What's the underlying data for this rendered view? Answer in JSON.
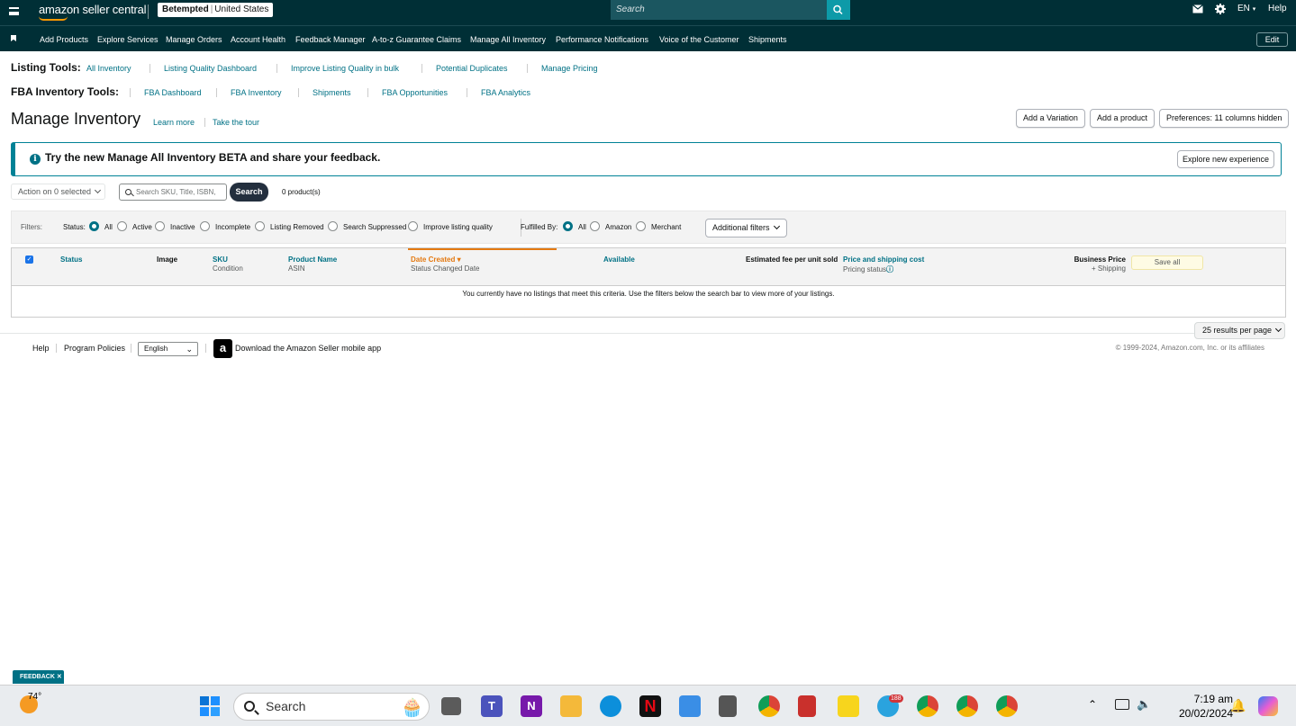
{
  "topbar": {
    "logo": "amazon seller central",
    "store_name": "Betempted",
    "store_region": "United States",
    "search_placeholder": "Search",
    "language": "EN",
    "help": "Help"
  },
  "nav": {
    "items": [
      "Add Products",
      "Explore Services",
      "Manage Orders",
      "Account Health",
      "Feedback Manager",
      "A-to-z Guarantee Claims",
      "Manage All Inventory",
      "Performance Notifications",
      "Voice of the Customer",
      "Shipments"
    ],
    "edit": "Edit"
  },
  "listing_tools": {
    "label": "Listing Tools:",
    "links": [
      "All Inventory",
      "Listing Quality Dashboard",
      "Improve Listing Quality in bulk",
      "Potential Duplicates",
      "Manage Pricing"
    ]
  },
  "fba_tools": {
    "label": "FBA Inventory Tools:",
    "links": [
      "FBA Dashboard",
      "FBA Inventory",
      "Shipments",
      "FBA Opportunities",
      "FBA Analytics"
    ]
  },
  "header": {
    "title": "Manage Inventory",
    "learn_more": "Learn more",
    "take_tour": "Take the tour",
    "add_variation": "Add a Variation",
    "add_product": "Add a product",
    "preferences": "Preferences: 11 columns hidden"
  },
  "banner": {
    "text": "Try the new Manage All Inventory BETA and share your feedback.",
    "button": "Explore new experience"
  },
  "toolbar": {
    "action": "Action on 0 selected",
    "search_placeholder": "Search SKU, Title, ISBN,",
    "search_button": "Search",
    "count": "0 product(s)"
  },
  "filters": {
    "label": "Filters:",
    "status_label": "Status:",
    "status_options": [
      "All",
      "Active",
      "Inactive",
      "Incomplete",
      "Listing Removed",
      "Search Suppressed",
      "Improve listing quality"
    ],
    "status_selected": "All",
    "fulfilled_label": "Fulfilled By:",
    "fulfilled_options": [
      "All",
      "Amazon",
      "Merchant"
    ],
    "fulfilled_selected": "All",
    "additional": "Additional filters"
  },
  "table": {
    "columns": {
      "status": "Status",
      "image": "Image",
      "sku": "SKU",
      "sku_sub": "Condition",
      "product_name": "Product Name",
      "product_sub": "ASIN",
      "date_created": "Date Created",
      "date_sub": "Status Changed Date",
      "available": "Available",
      "fee": "Estimated fee per unit sold",
      "price": "Price and shipping cost",
      "price_sub": "Pricing status",
      "business_price": "Business Price",
      "business_sub": "+ Shipping",
      "save_all": "Save all"
    },
    "empty_message": "You currently have no listings that meet this criteria. Use the filters below the search bar to view more of your listings."
  },
  "pagination": {
    "per_page": "25 results per page"
  },
  "footer": {
    "help": "Help",
    "program_policies": "Program Policies",
    "language": "English",
    "app_link": "Download the Amazon Seller mobile app",
    "copyright": "© 1999-2024, Amazon.com, Inc. or its affiliates"
  },
  "feedback_tab": "FEEDBACK",
  "taskbar": {
    "temperature": "74°",
    "search": "Search",
    "time": "7:19 am",
    "date": "20/02/2024",
    "telegram_badge": "188"
  }
}
